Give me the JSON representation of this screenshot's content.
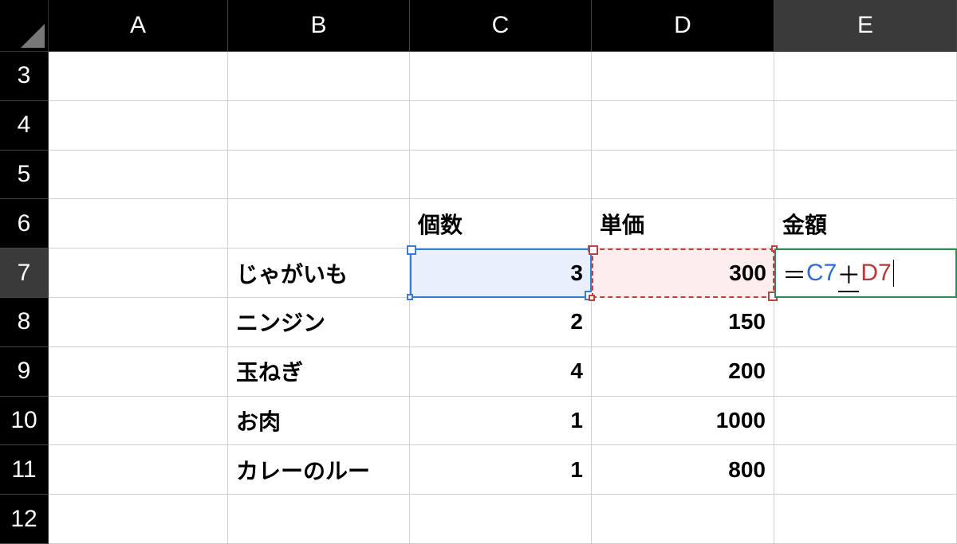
{
  "columns": [
    "A",
    "B",
    "C",
    "D",
    "E"
  ],
  "visible_rows": [
    3,
    4,
    5,
    6,
    7,
    8,
    9,
    10,
    11,
    12
  ],
  "active_cell": "E7",
  "active_formula": {
    "raw": "＝C7＋D7",
    "eq": "＝",
    "ref1": "C7",
    "plus": "＋",
    "ref2": "D7"
  },
  "referenced_cells": {
    "blue": "C7",
    "red": "D7"
  },
  "headers": {
    "C6": "個数",
    "D6": "単価",
    "E6": "金額"
  },
  "data": {
    "B7": "じゃがいも",
    "C7": "3",
    "D7": "300",
    "B8": "ニンジン",
    "C8": "2",
    "D8": "150",
    "B9": "玉ねぎ",
    "C9": "4",
    "D9": "200",
    "B10": "お肉",
    "C10": "1",
    "D10": "1000",
    "B11": "カレーのルー",
    "C11": "1",
    "D11": "800"
  }
}
